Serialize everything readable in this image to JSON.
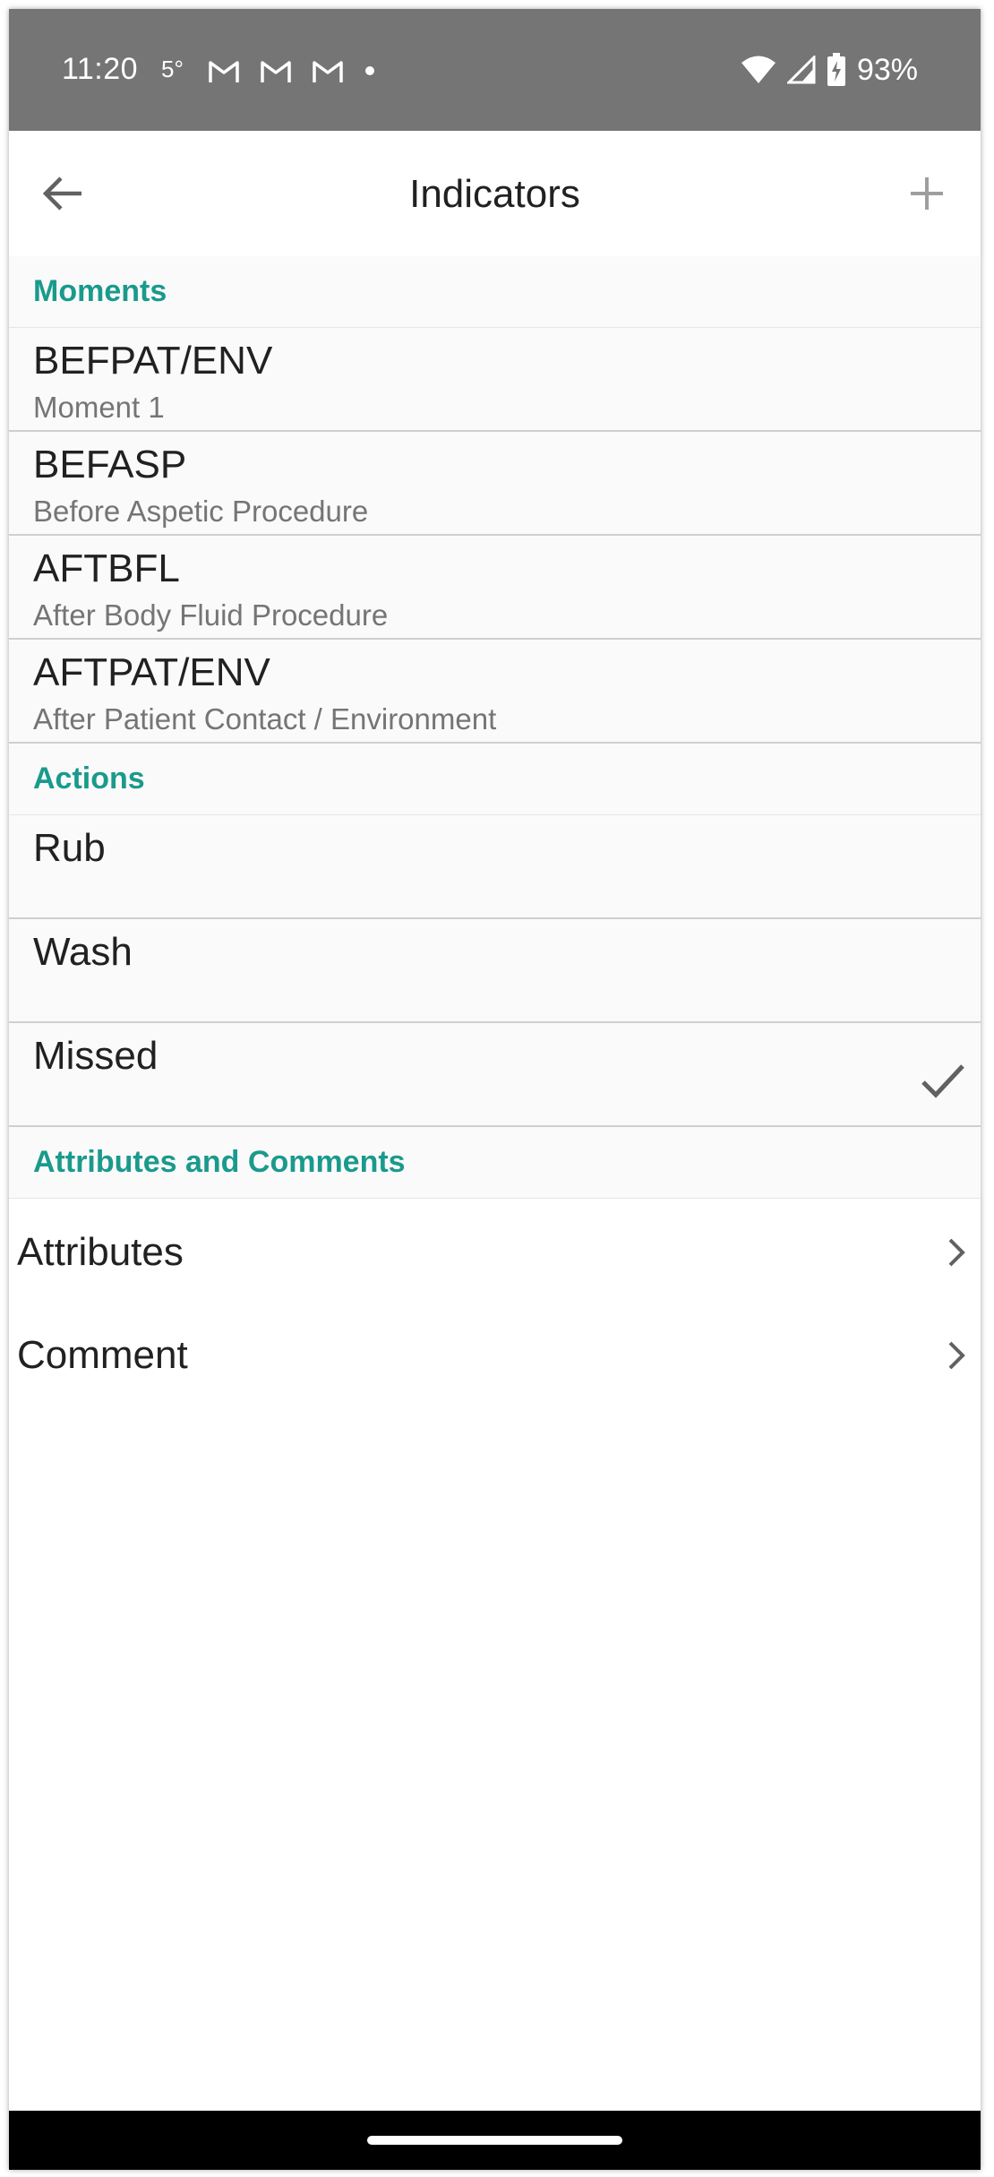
{
  "status_bar": {
    "time": "11:20",
    "temperature": "5°",
    "battery_percent": "93%"
  },
  "app_bar": {
    "title": "Indicators"
  },
  "sections": {
    "moments": {
      "header": "Moments",
      "items": [
        {
          "title": "BEFPAT/ENV",
          "subtitle": "Moment 1"
        },
        {
          "title": "BEFASP",
          "subtitle": "Before Aspetic Procedure"
        },
        {
          "title": "AFTBFL",
          "subtitle": "After Body Fluid Procedure"
        },
        {
          "title": "AFTPAT/ENV",
          "subtitle": "After Patient Contact / Environment"
        }
      ]
    },
    "actions": {
      "header": "Actions",
      "items": [
        {
          "title": "Rub",
          "checked": false
        },
        {
          "title": "Wash",
          "checked": false
        },
        {
          "title": "Missed",
          "checked": true
        }
      ]
    },
    "attributes_comments": {
      "header": "Attributes and Comments",
      "items": [
        {
          "label": "Attributes"
        },
        {
          "label": "Comment"
        }
      ]
    }
  },
  "colors": {
    "accent": "#1a9a8c",
    "status_bar": "#757575"
  },
  "icons": {
    "back": "arrow-left-icon",
    "add": "plus-icon",
    "check": "check-icon",
    "chevron": "chevron-right-icon"
  }
}
